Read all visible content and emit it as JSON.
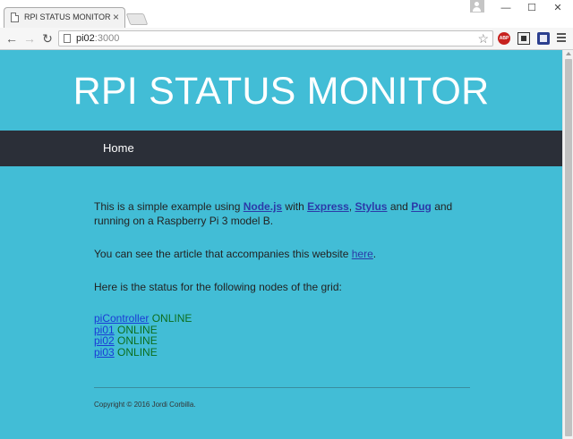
{
  "browser": {
    "tab_title": "RPI STATUS MONITOR",
    "tab_close": "×",
    "url_host": "pi02",
    "url_port": ":3000",
    "back": "←",
    "forward": "→",
    "reload": "↻",
    "bookmark_star": "☆",
    "abp_label": "ABP",
    "win_minimize": "—",
    "win_maximize": "☐",
    "win_close": "✕"
  },
  "header": {
    "title": "RPI STATUS MONITOR"
  },
  "nav": {
    "home": "Home"
  },
  "intro": {
    "prefix": "This is a simple example using ",
    "nodejs": "Node.js",
    "with": " with ",
    "express": "Express",
    "comma": ", ",
    "stylus": "Stylus",
    "and": " and ",
    "pug": "Pug",
    "suffix": " and running on a Raspberry Pi 3 model B."
  },
  "article": {
    "prefix": "You can see the article that accompanies this website ",
    "link": "here",
    "suffix": "."
  },
  "status_intro": "Here is the status for the following nodes of the grid:",
  "nodes": [
    {
      "name": "piController",
      "status": "ONLINE"
    },
    {
      "name": "pi01",
      "status": "ONLINE"
    },
    {
      "name": "pi02",
      "status": "ONLINE"
    },
    {
      "name": "pi03",
      "status": "ONLINE"
    }
  ],
  "footer": {
    "copyright": "Copyright © 2016 Jordi Corbilla."
  },
  "colors": {
    "page_bg": "#42bdd6",
    "navbar_bg": "#2b2f38",
    "online": "#0d6e1e",
    "link": "#2c3aa8"
  }
}
